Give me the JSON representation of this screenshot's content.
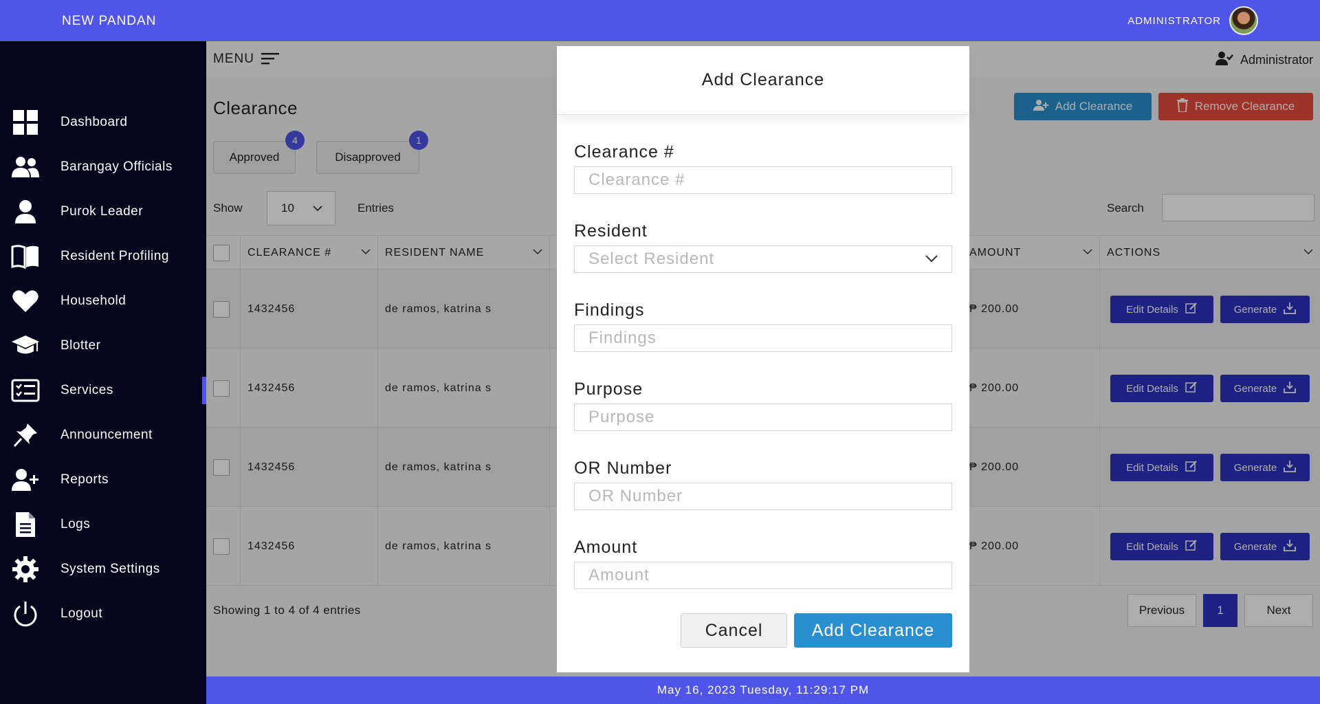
{
  "app": {
    "brand": "NEW PANDAN",
    "user_label": "ADMINISTRATOR"
  },
  "sidebar": {
    "items": [
      {
        "label": "Dashboard",
        "icon": "dashboard-grid-icon"
      },
      {
        "label": "Barangay Officials",
        "icon": "users-icon"
      },
      {
        "label": "Purok Leader",
        "icon": "user-icon"
      },
      {
        "label": "Resident Profiling",
        "icon": "book-icon"
      },
      {
        "label": "Household",
        "icon": "heart-icon"
      },
      {
        "label": "Blotter",
        "icon": "graduation-cap-icon"
      },
      {
        "label": "Services",
        "icon": "checklist-icon",
        "active": true
      },
      {
        "label": "Announcement",
        "icon": "pin-icon"
      },
      {
        "label": "Reports",
        "icon": "user-plus-icon"
      },
      {
        "label": "Logs",
        "icon": "document-icon"
      },
      {
        "label": "System Settings",
        "icon": "gear-icon"
      },
      {
        "label": "Logout",
        "icon": "power-icon"
      }
    ]
  },
  "header": {
    "menu_label": "MENU",
    "user": "Administrator"
  },
  "page": {
    "title": "Clearance",
    "add_button": "Add Clearance",
    "remove_button": "Remove Clearance",
    "tabs": [
      {
        "label": "Approved",
        "count": "4"
      },
      {
        "label": "Disapproved",
        "count": "1"
      }
    ],
    "show_label": "Show",
    "entries_value": "10",
    "entries_label": "Entries",
    "search_label": "Search"
  },
  "table": {
    "headers": {
      "clearance": "CLEARANCE #",
      "resident": "RESIDENT NAME",
      "amount": "AMOUNT",
      "actions": "ACTIONS"
    },
    "rows": [
      {
        "clearance": "1432456",
        "resident": "de ramos, katrina s",
        "amount": "₱ 200.00"
      },
      {
        "clearance": "1432456",
        "resident": "de ramos, katrina s",
        "amount": "₱ 200.00"
      },
      {
        "clearance": "1432456",
        "resident": "de ramos, katrina s",
        "amount": "₱ 200.00"
      },
      {
        "clearance": "1432456",
        "resident": "de ramos, katrina s",
        "amount": "₱ 200.00"
      }
    ],
    "edit_label": "Edit Details",
    "generate_label": "Generate",
    "showing": "Showing 1 to 4 of 4 entries",
    "prev": "Previous",
    "page": "1",
    "next": "Next"
  },
  "footer": {
    "datetime": "May 16, 2023 Tuesday, 11:29:17 PM"
  },
  "modal": {
    "title": "Add Clearance",
    "fields": [
      {
        "label": "Clearance #",
        "placeholder": "Clearance #"
      },
      {
        "label": "Resident",
        "placeholder": "Select Resident"
      },
      {
        "label": "Findings",
        "placeholder": "Findings"
      },
      {
        "label": "Purpose",
        "placeholder": "Purpose"
      },
      {
        "label": "OR Number",
        "placeholder": "OR Number"
      },
      {
        "label": "Amount",
        "placeholder": "Amount"
      }
    ],
    "cancel": "Cancel",
    "submit": "Add Clearance"
  },
  "colors": {
    "topbar": "#4f55e8",
    "sidebar": "#04041c",
    "primary_button": "#2c32c0",
    "add_button": "#2a8fcf",
    "remove_button": "#e74c3c"
  }
}
